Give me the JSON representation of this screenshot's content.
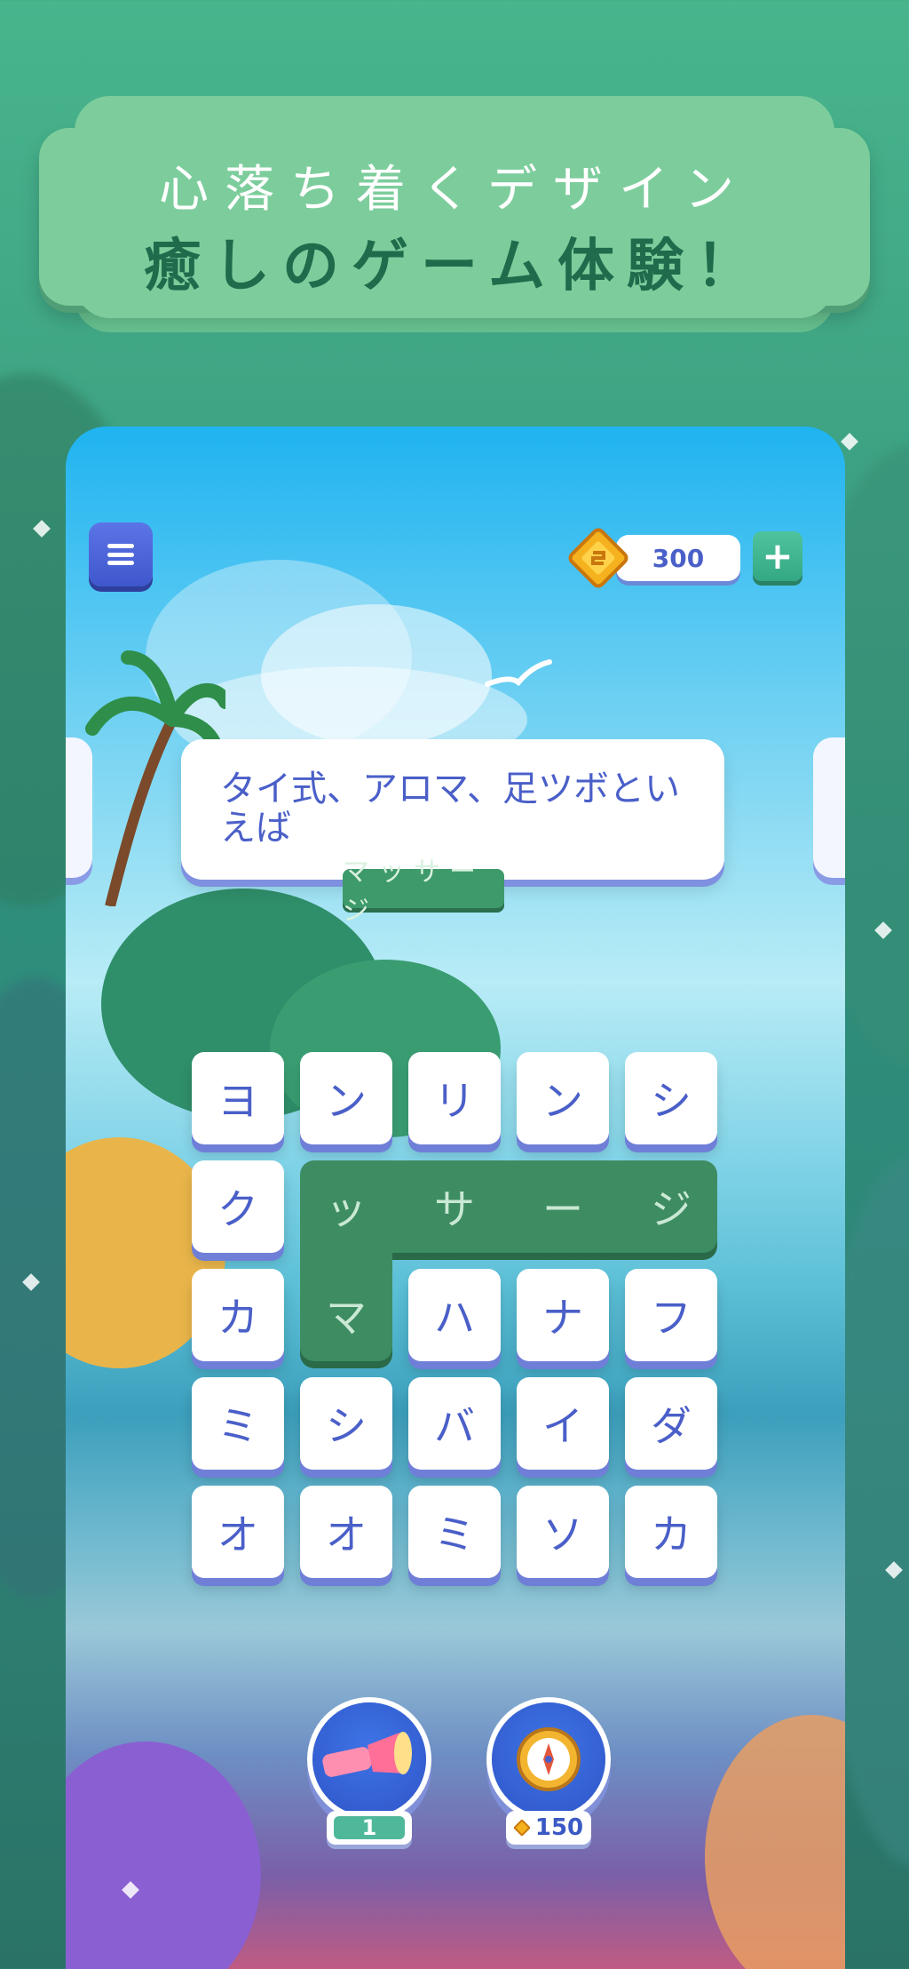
{
  "banner": {
    "line1": "心落ち着くデザイン",
    "line2": "癒しのゲーム体験！"
  },
  "header": {
    "coins": "300"
  },
  "clue": {
    "text": "タイ式、アロマ、足ツボといえば",
    "answer": "マッサージ"
  },
  "grid": {
    "rows": [
      [
        "ヨ",
        "ン",
        "リ",
        "ン",
        "シ"
      ],
      [
        "ク",
        "",
        "",
        "",
        ""
      ],
      [
        "カ",
        "",
        "ハ",
        "ナ",
        "フ"
      ],
      [
        "ミ",
        "シ",
        "バ",
        "イ",
        "ダ"
      ],
      [
        "オ",
        "オ",
        "ミ",
        "ソ",
        "カ"
      ]
    ],
    "found_word_letters": [
      "ッ",
      "サ",
      "ー",
      "ジ",
      "マ"
    ]
  },
  "boosters": {
    "flashlight_count": "1",
    "compass_cost": "150"
  },
  "colors": {
    "background": "#3fa584",
    "banner": "#7dcd9c",
    "banner_text_dark": "#1f6b4c",
    "tile_text": "#4a5fc8",
    "found_word": "#3e8c62"
  },
  "icons": {
    "menu": "hamburger-icon",
    "coin": "gem-coin-icon",
    "add": "plus-icon",
    "flashlight": "flashlight-icon",
    "compass": "compass-icon"
  }
}
